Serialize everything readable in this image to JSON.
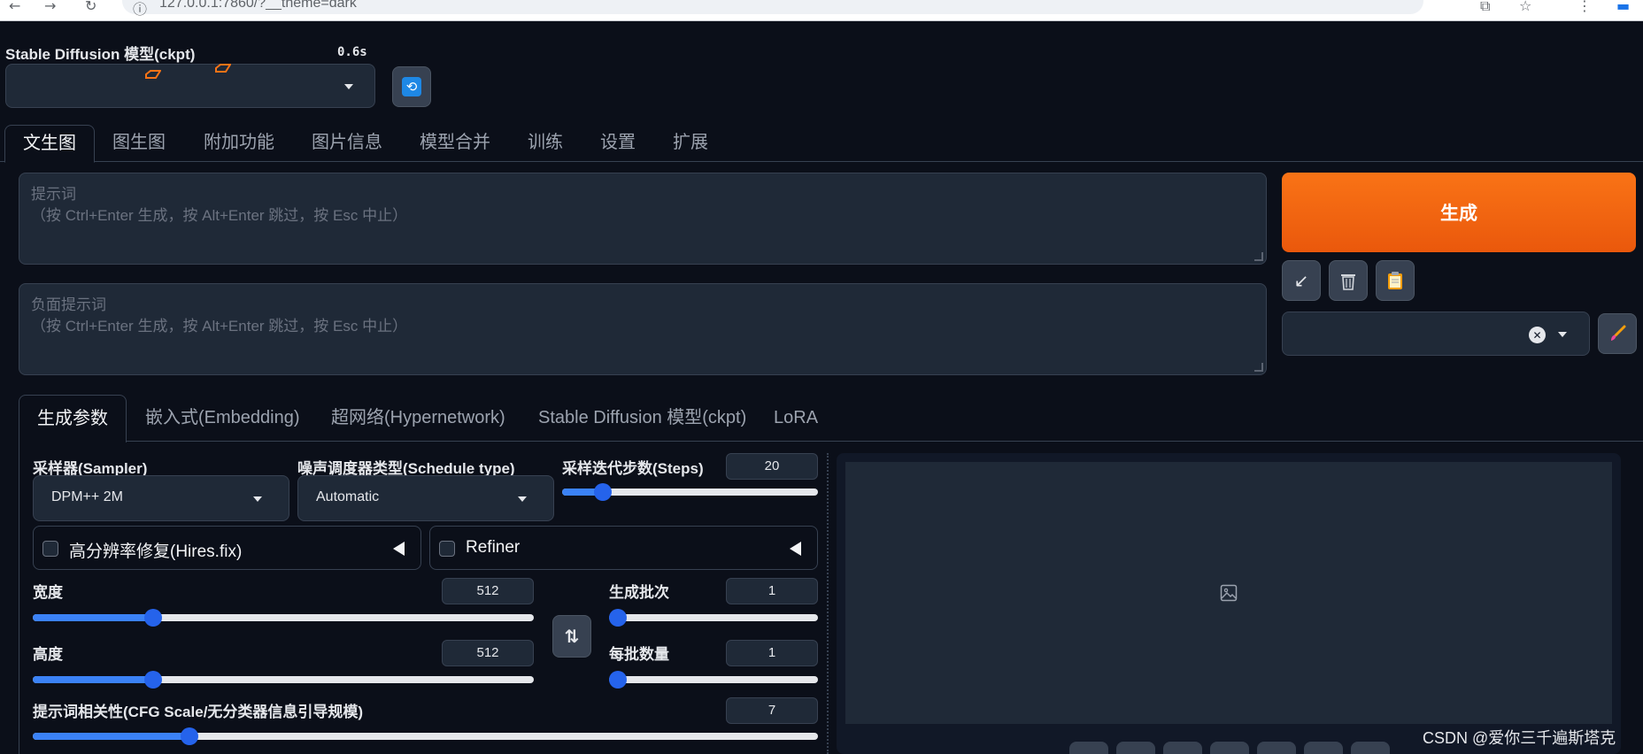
{
  "browser": {
    "url": "127.0.0.1:7860/?__theme=dark"
  },
  "checkpoint": {
    "label": "Stable Diffusion 模型(ckpt)",
    "load_time": "0.6s",
    "selected": ""
  },
  "main_tabs": [
    {
      "label": "文生图",
      "active": true
    },
    {
      "label": "图生图"
    },
    {
      "label": "附加功能"
    },
    {
      "label": "图片信息"
    },
    {
      "label": "模型合并"
    },
    {
      "label": "训练"
    },
    {
      "label": "设置"
    },
    {
      "label": "扩展"
    }
  ],
  "prompt": {
    "placeholder_title": "提示词",
    "placeholder_hint": "（按 Ctrl+Enter 生成，按 Alt+Enter 跳过，按 Esc 中止）"
  },
  "negative_prompt": {
    "placeholder_title": "负面提示词",
    "placeholder_hint": "（按 Ctrl+Enter 生成，按 Alt+Enter 跳过，按 Esc 中止）"
  },
  "generate_label": "生成",
  "sub_tabs": [
    {
      "label": "生成参数",
      "active": true
    },
    {
      "label": "嵌入式(Embedding)"
    },
    {
      "label": "超网络(Hypernetwork)"
    },
    {
      "label": "Stable Diffusion 模型(ckpt)"
    },
    {
      "label": "LoRA"
    }
  ],
  "params": {
    "sampler": {
      "label": "采样器(Sampler)",
      "value": "DPM++ 2M"
    },
    "schedule": {
      "label": "噪声调度器类型(Schedule type)",
      "value": "Automatic"
    },
    "steps": {
      "label": "采样迭代步数(Steps)",
      "value": "20",
      "fraction": 0.16
    },
    "hires": {
      "label": "高分辨率修复(Hires.fix)"
    },
    "refiner": {
      "label": "Refiner"
    },
    "width": {
      "label": "宽度",
      "value": "512",
      "fraction": 0.24
    },
    "height": {
      "label": "高度",
      "value": "512",
      "fraction": 0.24
    },
    "batch_count": {
      "label": "生成批次",
      "value": "1",
      "fraction": 0.0
    },
    "batch_size": {
      "label": "每批数量",
      "value": "1",
      "fraction": 0.0
    },
    "cfg": {
      "label": "提示词相关性(CFG Scale/无分类器信息引导规模)",
      "value": "7",
      "fraction": 0.2
    }
  },
  "icons": {
    "refresh": "refresh-icon",
    "arrow": "arrow-down-left-icon",
    "trash": "trash-icon",
    "clipboard": "clipboard-icon",
    "brush": "brush-icon",
    "swap": "swap-icon",
    "image": "image-placeholder-icon"
  },
  "colors": {
    "background": "#0b0f19",
    "generate": "#ea580c",
    "accent": "#2563eb"
  },
  "watermark": "CSDN @爱你三千遍斯塔克"
}
